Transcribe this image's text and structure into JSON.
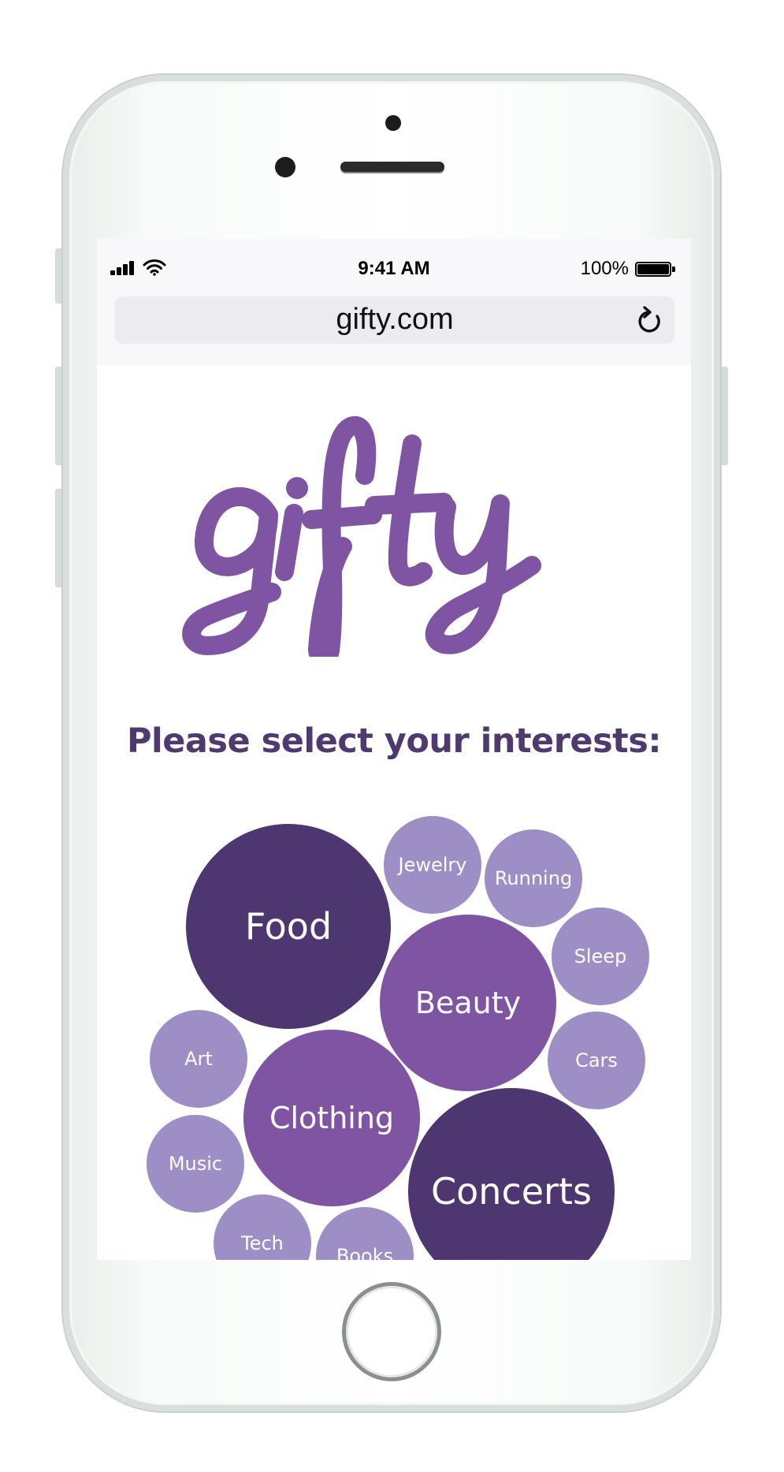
{
  "status_bar": {
    "time": "9:41 AM",
    "battery_percent": "100%",
    "signal_icon": "cellular-signal-icon",
    "wifi_icon": "wifi-icon",
    "battery_icon": "battery-full-icon"
  },
  "browser": {
    "url": "gifty.com",
    "reload_icon": "reload-icon"
  },
  "logo": {
    "text": "gifty",
    "color": "#7f55a3"
  },
  "prompt": "Please select your interests:",
  "colors": {
    "prompt_text": "#4e3a6f",
    "bubble_dark": "#4e3670",
    "bubble_mid": "#7f55a3",
    "bubble_light": "#9d8ec6"
  },
  "interests": {
    "food": "Food",
    "jewelry": "Jewelry",
    "running": "Running",
    "beauty": "Beauty",
    "sleep": "Sleep",
    "art": "Art",
    "cars": "Cars",
    "clothing": "Clothing",
    "music": "Music",
    "concerts": "Concerts",
    "tech": "Tech",
    "books": "Books"
  }
}
